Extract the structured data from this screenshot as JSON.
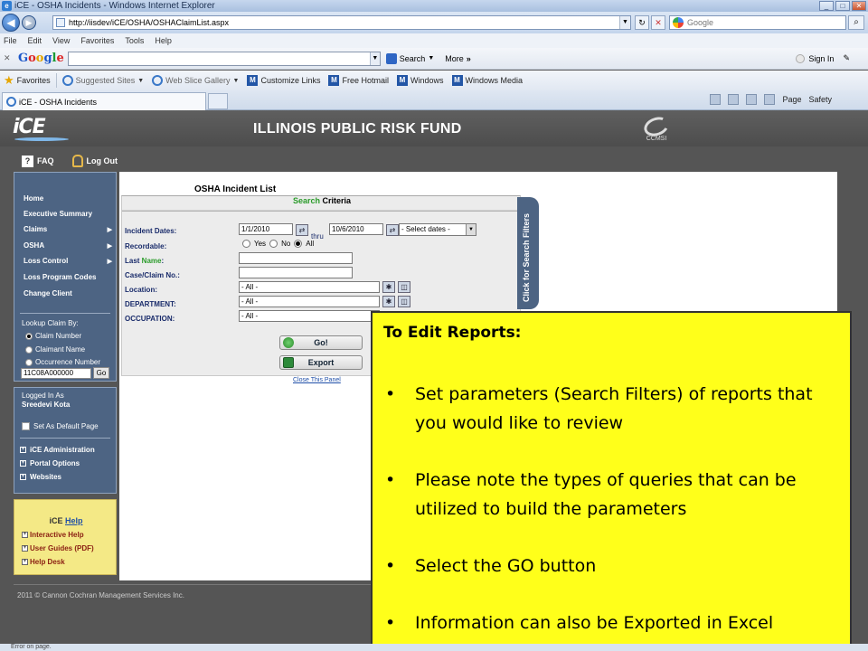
{
  "window": {
    "title": "iCE - OSHA Incidents - Windows Internet Explorer"
  },
  "address": {
    "url": "http://iisdev/iCE/OSHA/OSHAClaimList.aspx"
  },
  "search_engine": {
    "placeholder": "Google"
  },
  "menu": [
    "File",
    "Edit",
    "View",
    "Favorites",
    "Tools",
    "Help"
  ],
  "google_toolbar": {
    "search_label": "Search",
    "more_label": "More",
    "signin_label": "Sign In"
  },
  "favorites": {
    "label": "Favorites",
    "items": [
      "Suggested Sites",
      "Web Slice Gallery",
      "Customize Links",
      "Free Hotmail",
      "Windows",
      "Windows Media"
    ]
  },
  "tab": {
    "title": "iCE - OSHA Incidents"
  },
  "command_bar": {
    "page_label": "Page",
    "safety_label": "Safety"
  },
  "app": {
    "logo": "iCE",
    "title": "ILLINOIS PUBLIC RISK FUND",
    "partner_logo": "CCMSI",
    "links": {
      "faq": "FAQ",
      "logout": "Log Out"
    }
  },
  "sidebar": {
    "items": [
      {
        "label": "Home"
      },
      {
        "label": "Executive Summary"
      },
      {
        "label": "Claims",
        "arrow": "▶"
      },
      {
        "label": "OSHA",
        "arrow": "▶"
      },
      {
        "label": "Loss Control",
        "arrow": "▶"
      },
      {
        "label": "Loss Program Codes"
      },
      {
        "label": "Change Client"
      }
    ],
    "lookup_label": "Lookup Claim By:",
    "lookup_options": [
      "Claim Number",
      "Claimant Name",
      "Occurrence Number"
    ],
    "claim_value": "11C08A000000",
    "go_label": "Go"
  },
  "user_panel": {
    "logged_in_as": "Logged In As",
    "user_name": "Sreedevi Kota",
    "default_page_label": "Set As Default Page",
    "links": [
      "iCE Administration",
      "Portal Options",
      "Websites"
    ]
  },
  "help_panel": {
    "title_prefix": "iCE",
    "title_link": "Help",
    "links": [
      "Interactive Help",
      "User Guides (PDF)",
      "Help Desk"
    ]
  },
  "footer": {
    "copyright": "2011 © Cannon Cochran Management Services Inc."
  },
  "osha": {
    "title": "OSHA Incident List",
    "criteria_g": "Search",
    "criteria_rest": " Criteria",
    "side_tab": "Click for Search Filters",
    "labels": {
      "incident_dates": "Incident Dates:",
      "recordable": "Recordable:",
      "last_name_a": "Last ",
      "last_name_b": "Name",
      "last_name_c": ":",
      "case_claim": "Case/Claim No.:",
      "location": "Location:",
      "department": "DEPARTMENT:",
      "occupation": "OCCUPATION:"
    },
    "date_from": "1/1/2010",
    "thru": "thru",
    "date_to": "10/6/2010",
    "date_select": "- Select dates -",
    "recordable_options": [
      "Yes",
      "No",
      "All"
    ],
    "location_value": "- All -",
    "department_value": "- All -",
    "occupation_value": "- All -",
    "go_label": "Go!",
    "export_label": "Export",
    "close_panel": "Close This Panel"
  },
  "callout": {
    "title": "To Edit Reports:",
    "bullets": [
      "Set parameters (Search Filters) of reports that you would like to review",
      "Please note the types of queries that can be utilized to build the parameters",
      "Select the GO button",
      "Information can also be Exported in Excel"
    ]
  },
  "status": {
    "text": "Error on page."
  }
}
